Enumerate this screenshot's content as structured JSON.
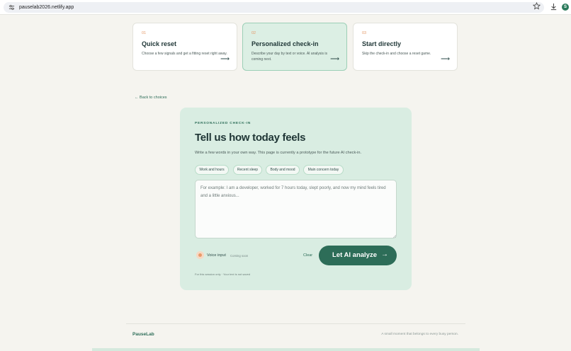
{
  "browser": {
    "url": "pauselab2026.netlify.app",
    "profile_initial": "S",
    "icons": [
      "tune-icon",
      "star-icon",
      "download-icon"
    ]
  },
  "options": [
    {
      "num": "01",
      "title": "Quick reset",
      "desc": "Choose a few signals and get a fitting reset right away.",
      "arrow": "⟶"
    },
    {
      "num": "02",
      "title": "Personalized check-in",
      "desc": "Describe your day by text or voice. AI analysis is coming next.",
      "arrow": "⟶"
    },
    {
      "num": "03",
      "title": "Start directly",
      "desc": "Skip the check-in and choose a reset game.",
      "arrow": "⟶"
    }
  ],
  "back_link": "← Back to choices",
  "panel": {
    "eyebrow": "PERSONALIZED CHECK-IN",
    "title": "Tell us how today feels",
    "subtitle": "Write a few words in your own way. This page is currently a prototype for the future AI check-in.",
    "chips": [
      "Work and hours",
      "Recent sleep",
      "Body and mood",
      "Main concern today"
    ],
    "textarea_placeholder": "For example: I am a developer, worked for 7 hours today, slept poorly, and now my mind feels tired and a little anxious...",
    "voice_label": "Voice input",
    "voice_soon": "Coming soon",
    "clear_label": "Clear",
    "analyze_label": "Let AI analyze",
    "analyze_arrow": "→",
    "footnote": "For this session only  ·  Your text is not saved"
  },
  "footer": {
    "brand": "PauseLab",
    "tagline": "A small moment that belongs to every busy person."
  },
  "colors": {
    "accent": "#2d6d58",
    "panel_bg": "#d9ede2",
    "page_bg": "#f5f4ef",
    "number_orange": "#e59a6a"
  }
}
